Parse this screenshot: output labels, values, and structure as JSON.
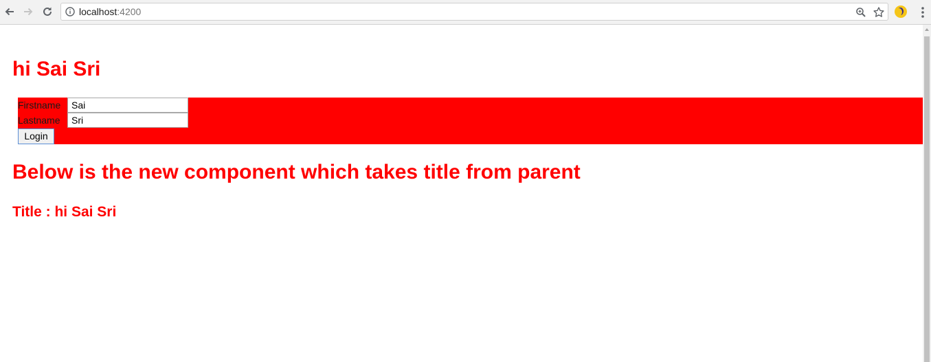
{
  "browser": {
    "url_host": "localhost",
    "url_port": ":4200",
    "icons": {
      "back": "arrow-left-icon",
      "forward": "arrow-right-icon",
      "reload": "reload-icon",
      "info": "info-icon",
      "zoom": "zoom-icon",
      "bookmark": "star-icon",
      "extension": "extension-icon",
      "menu": "kebab-menu-icon"
    }
  },
  "page": {
    "heading": "hi Sai Sri",
    "form": {
      "firstname_label": "Firstname",
      "firstname_value": "Sai",
      "lastname_label": "Lastname",
      "lastname_value": "Sri",
      "login_label": "Login"
    },
    "section_heading": "Below is the new component which takes title from parent",
    "child_title": "Title : hi Sai Sri"
  },
  "colors": {
    "accent": "#ff0000",
    "form_background": "#ff0000",
    "button_border": "#5b8fd6"
  }
}
